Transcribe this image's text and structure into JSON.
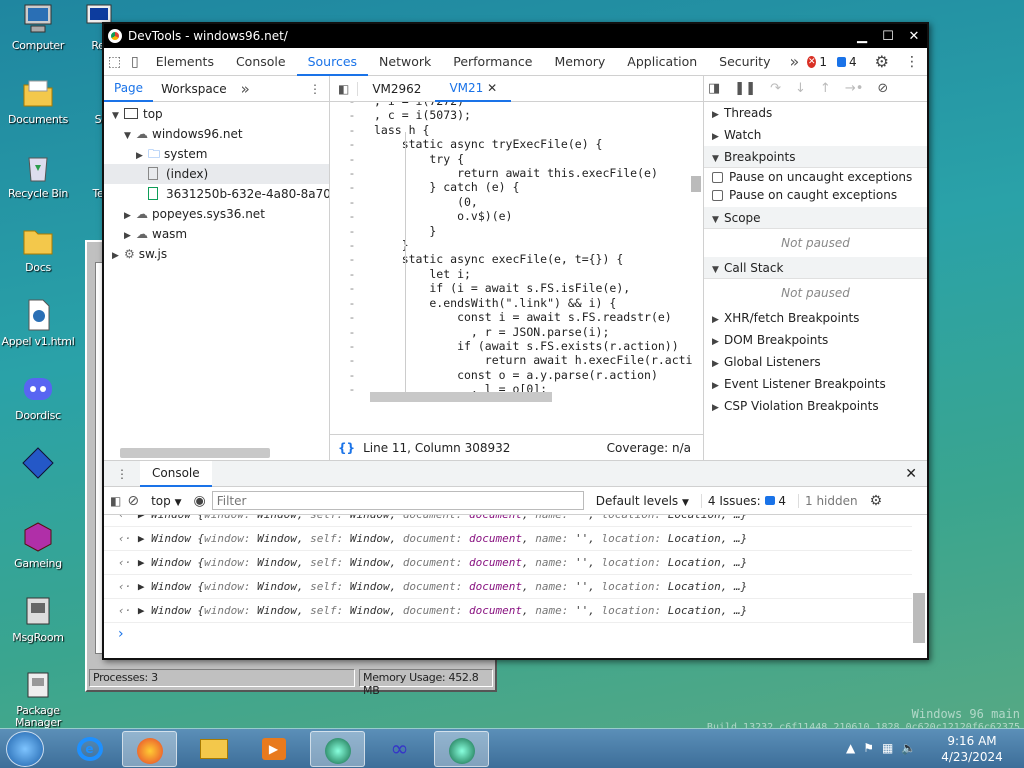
{
  "desktop": {
    "icons": [
      {
        "label": "Computer"
      },
      {
        "label": "Re"
      },
      {
        "label": "Documents"
      },
      {
        "label": "S"
      },
      {
        "label": "Recycle Bin"
      },
      {
        "label": "Te"
      },
      {
        "label": "Docs"
      },
      {
        "label": "Appel v1.html"
      },
      {
        "label": "Doordisc"
      },
      {
        "label": "Gameing"
      },
      {
        "label": "MsgRoom"
      },
      {
        "label": "Package Manager"
      }
    ],
    "watermark_line1": "Windows 96 main",
    "watermark_line2": "Build 13232 c6f11448 210610 1828 0c620c12120f6c62375"
  },
  "bg_window": {
    "processes": "Processes: 3",
    "memory": "Memory Usage: 452.8 MB"
  },
  "devtools": {
    "title": "DevTools - windows96.net/",
    "tabs": [
      "Elements",
      "Console",
      "Sources",
      "Network",
      "Performance",
      "Memory",
      "Application",
      "Security"
    ],
    "active_tab": "Sources",
    "more_tabs": "»",
    "errors": "1",
    "messages": "4",
    "nav": {
      "page": "Page",
      "workspace": "Workspace",
      "more": "»"
    },
    "tree": {
      "top": "top",
      "host": "windows96.net",
      "system": "system",
      "index": "(index)",
      "file": "3631250b-632e-4a80-8a70-31",
      "popeyes": "popeyes.sys36.net",
      "wasm": "wasm",
      "sw": "sw.js"
    },
    "editor_tabs": [
      "VM2962",
      "VM21"
    ],
    "status": {
      "position": "Line 11, Column 308932",
      "coverage": "Coverage: n/a"
    },
    "code": [
      ", i = i(7272)",
      ", c = i(5073);",
      "lass h {",
      "    static async tryExecFile(e) {",
      "        try {",
      "            return await this.execFile(e)",
      "        } catch (e) {",
      "            (0,",
      "            o.v$)(e)",
      "        }",
      "    }",
      "    static async execFile(e, t={}) {",
      "        let i;",
      "        if (i = await s.FS.isFile(e),",
      "        e.endsWith(\".link\") && i) {",
      "            const i = await s.FS.readstr(e)",
      "              , r = JSON.parse(i);",
      "            if (await s.FS.exists(r.action))",
      "                return await h.execFile(r.acti",
      "            const o = a.y.parse(r.action)",
      "              , l = o[0];",
      "            return o.shift(),"
    ],
    "debugger": {
      "threads": "Threads",
      "watch": "Watch",
      "breakpoints": "Breakpoints",
      "pause_uncaught": "Pause on uncaught exceptions",
      "pause_caught": "Pause on caught exceptions",
      "scope": "Scope",
      "not_paused": "Not paused",
      "call_stack": "Call Stack",
      "xhr": "XHR/fetch Breakpoints",
      "dom": "DOM Breakpoints",
      "global": "Global Listeners",
      "event": "Event Listener Breakpoints",
      "csp": "CSP Violation Breakpoints"
    },
    "console": {
      "tab": "Console",
      "context": "top",
      "filter_placeholder": "Filter",
      "levels": "Default levels",
      "issues_label": "4 Issues:",
      "issues_count": "4",
      "hidden": "1 hidden",
      "row": {
        "cls": "Window",
        "k1": "window",
        "v1": "Window",
        "k2": "self",
        "v2": "Window",
        "k3": "document",
        "v3": "document",
        "k4": "name",
        "v4": "''",
        "k5": "location",
        "v5": "Location",
        "tail": "…}"
      },
      "prompt": "›"
    }
  },
  "taskbar": {
    "time": "9:16 AM",
    "date": "4/23/2024"
  }
}
